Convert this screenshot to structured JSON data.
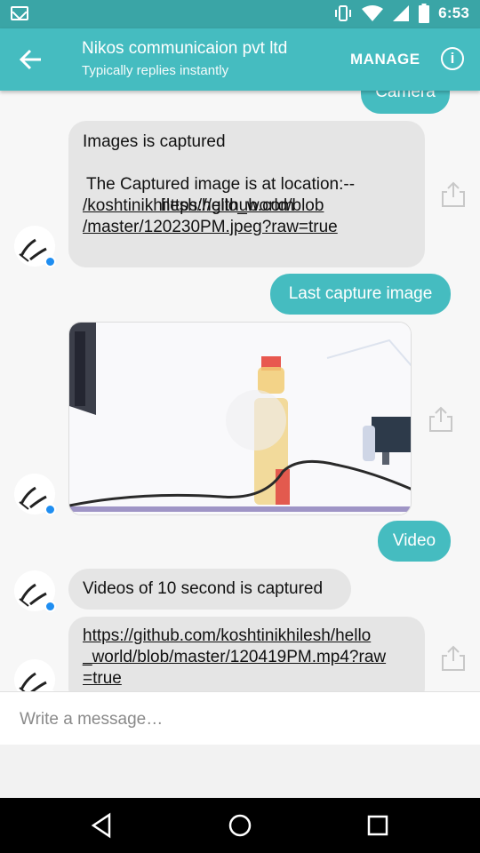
{
  "status_bar": {
    "time": "6:53"
  },
  "header": {
    "title": "Nikos communicaion pvt ltd",
    "subtitle": "Typically replies instantly",
    "manage_label": "MANAGE"
  },
  "messages": {
    "camera_label": "Camera",
    "captured_title": "Images is captured",
    "captured_location_prefix": "The Captured image is at location:--",
    "captured_link_line1": "https://github.com",
    "captured_link_line2": "/koshtinikhilesh/hello_world/blob",
    "captured_link_line3": "/master/120230PM.jpeg?raw=true",
    "last_capture_label": "Last capture image",
    "video_label": "Video",
    "video_captured": "Videos of 10 second is captured",
    "video_link_line1": "https://github.com/koshtinikhilesh/hello",
    "video_link_line2": "_world/blob/master/120419PM.mp4?raw",
    "video_link_line3": "=true"
  },
  "composer": {
    "placeholder": "Write a message…"
  },
  "colors": {
    "header": "#45bcc0",
    "status_bar": "#3aa5a6",
    "incoming": "#e5e5e5",
    "outgoing": "#45bcc0"
  }
}
